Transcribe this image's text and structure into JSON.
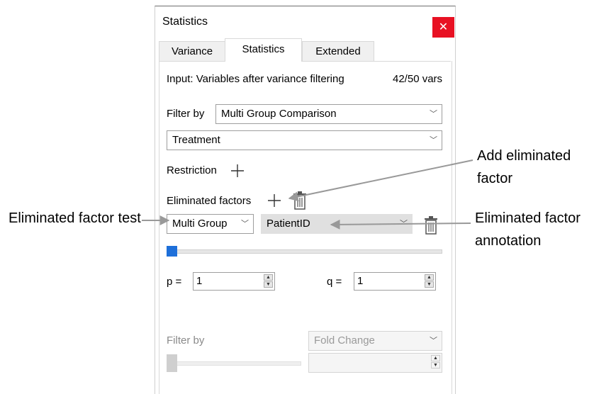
{
  "window": {
    "title": "Statistics",
    "close_icon": "close-icon"
  },
  "tabs": [
    {
      "label": "Variance"
    },
    {
      "label": "Statistics",
      "active": true
    },
    {
      "label": "Extended"
    }
  ],
  "input": {
    "label": "Input: Variables after variance filtering",
    "count": "42/50 vars"
  },
  "filter": {
    "label": "Filter by",
    "method": "Multi Group Comparison",
    "group": "Treatment"
  },
  "restriction": {
    "label": "Restriction"
  },
  "eliminated": {
    "label": "Eliminated factors",
    "test": "Multi Group",
    "annotation": "PatientID"
  },
  "slider_level": 0,
  "p": {
    "label": "p =",
    "value": "1"
  },
  "q": {
    "label": "q =",
    "value": "1"
  },
  "filter2": {
    "label": "Filter by",
    "method": "Fold Change",
    "value": ""
  },
  "callouts": {
    "add_factor": "Add eliminated factor",
    "factor_test": "Eliminated factor test",
    "factor_annotation": "Eliminated factor annotation"
  },
  "colors": {
    "close": "#e81123",
    "slider_handle": "#1e6fd9",
    "annotation_line": "#999999"
  }
}
